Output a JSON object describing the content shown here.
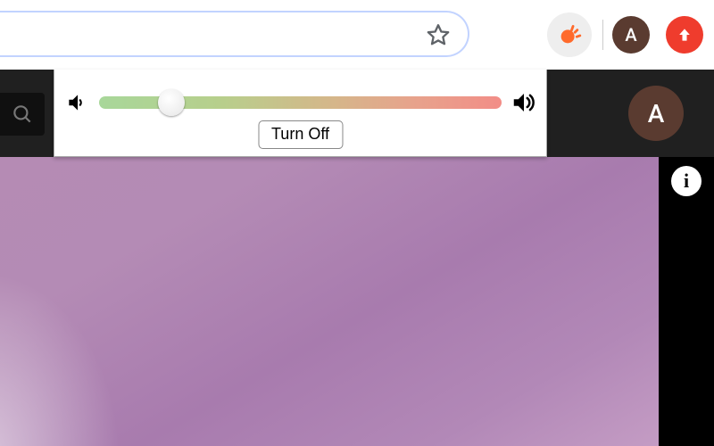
{
  "toolbar": {
    "avatar_letter": "A",
    "extension_icon": "volume-burst-icon",
    "brand_color": "#ff6a2b"
  },
  "site_header": {
    "avatar_letter": "A"
  },
  "popup": {
    "turn_off_label": "Turn Off",
    "slider_percent": 18
  },
  "info_glyph": "i"
}
